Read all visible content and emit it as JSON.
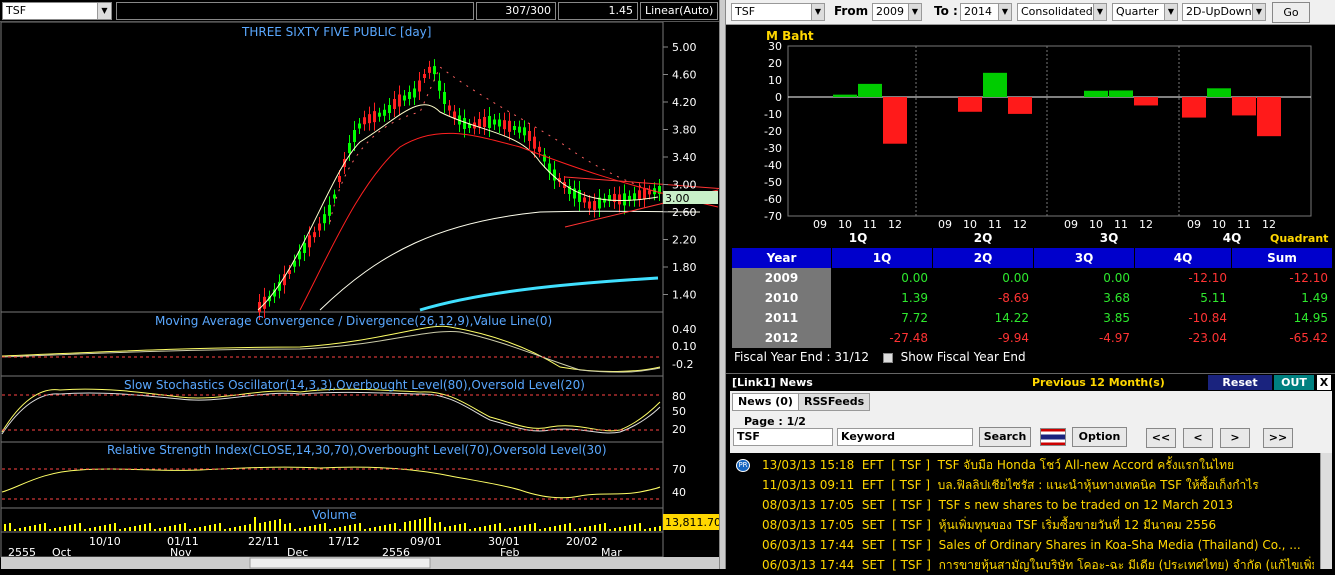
{
  "left": {
    "symbol": "TSF",
    "bars_info": "307/300",
    "zoom": "1.45",
    "scale": "Linear(Auto)",
    "chart_title": "THREE SIXTY FIVE PUBLIC [day]",
    "price_ticks": [
      "5.00",
      "4.60",
      "4.20",
      "3.80",
      "3.40",
      "3.00",
      "2.60",
      "2.20",
      "1.80",
      "1.40"
    ],
    "last_price": "3.00",
    "macd_title": "Moving Average Convergence / Divergence(26,12,9),Value Line(0)",
    "macd_ticks": [
      "0.40",
      "0.10",
      "-0.2"
    ],
    "stoch_title": "Slow Stochastics Oscillator(14,3,3),Overbought Level(80),Oversold Level(20)",
    "stoch_ticks": [
      "80",
      "50",
      "20"
    ],
    "rsi_title": "Relative Strength Index(CLOSE,14,30,70),Overbought Level(70),Oversold Level(30)",
    "rsi_ticks": [
      "70",
      "40"
    ],
    "volume_title": "Volume",
    "volume_value": "13,811.70",
    "date_top": [
      "10/10",
      "01/11",
      "22/11",
      "17/12",
      "09/01",
      "30/01",
      "20/02"
    ],
    "date_bottom": [
      "2555",
      "Oct",
      "Nov",
      "Dec",
      "2556",
      "Feb",
      "Mar"
    ]
  },
  "right": {
    "symbol": "TSF",
    "from_label": "From :",
    "from_year": "2009",
    "to_label": "To :",
    "to_year": "2014",
    "statement": "Consolidated",
    "period": "Quarter",
    "chart_mode": "2D-UpDown",
    "go_label": "Go",
    "unit": "M Baht",
    "quadrant_label": "Quadrant",
    "fiscal_text": "Fiscal  Year  End  :  31/12",
    "show_fiscal_label": "Show Fiscal Year End"
  },
  "chart_data": {
    "type": "bar",
    "ylabel": "M Baht",
    "ylim": [
      -70,
      30
    ],
    "yticks": [
      30,
      20,
      10,
      0,
      -10,
      -20,
      -30,
      -40,
      -50,
      -60,
      -70
    ],
    "groups": [
      "1Q",
      "2Q",
      "3Q",
      "4Q"
    ],
    "x_labels": [
      "09",
      "10",
      "11",
      "12"
    ],
    "series": [
      {
        "values": [
          0.0,
          1.39,
          7.72,
          -27.48
        ]
      },
      {
        "values": [
          0.0,
          -8.69,
          14.22,
          -9.94
        ]
      },
      {
        "values": [
          0.0,
          3.68,
          3.85,
          -4.97
        ]
      },
      {
        "values": [
          -12.1,
          5.11,
          -10.84,
          -23.04
        ]
      }
    ]
  },
  "table": {
    "headers": [
      "Year",
      "1Q",
      "2Q",
      "3Q",
      "4Q",
      "Sum"
    ],
    "rows": [
      {
        "year": "2009",
        "vals": [
          "0.00",
          "0.00",
          "0.00",
          "-12.10",
          "-12.10"
        ]
      },
      {
        "year": "2010",
        "vals": [
          "1.39",
          "-8.69",
          "3.68",
          "5.11",
          "1.49"
        ]
      },
      {
        "year": "2011",
        "vals": [
          "7.72",
          "14.22",
          "3.85",
          "-10.84",
          "14.95"
        ]
      },
      {
        "year": "2012",
        "vals": [
          "-27.48",
          "-9.94",
          "-4.97",
          "-23.04",
          "-65.42"
        ]
      }
    ]
  },
  "news": {
    "panel_title": "[Link1] News",
    "period": "Previous 12 Month(s)",
    "reset": "Reset",
    "out": "OUT",
    "close": "X",
    "tab_news": "News (0)",
    "tab_rss": "RSSFeeds",
    "page": "Page : 1/2",
    "symbol": "TSF",
    "keyword": "Keyword",
    "search": "Search",
    "option": "Option",
    "first": "<<",
    "prev": "<",
    "next": ">",
    "last": ">>",
    "items": [
      {
        "dt": "13/03/13 15:18",
        "src": "EFT",
        "sym": "[ TSF ]",
        "title": "TSF จับมือ Honda โชว์ All-new Accord ครั้งแรกในไทย"
      },
      {
        "dt": "11/03/13 09:11",
        "src": "EFT",
        "sym": "[ TSF ]",
        "title": "บล.ฟิลลิปเชียไซรัส : แนะนำหุ้นทางเทคนิค TSF ให้ซื้อเก็งกำไร"
      },
      {
        "dt": "08/03/13 17:05",
        "src": "SET",
        "sym": "[ TSF ]",
        "title": "TSF s new shares to be traded on 12 March 2013"
      },
      {
        "dt": "08/03/13 17:05",
        "src": "SET",
        "sym": "[ TSF ]",
        "title": "หุ้นเพิ่มทุนของ TSF เริ่มซื้อขายวันที่ 12 มีนาคม 2556"
      },
      {
        "dt": "06/03/13 17:44",
        "src": "SET",
        "sym": "[ TSF ]",
        "title": "Sales of Ordinary Shares in Koa-Sha Media (Thailand) Co., ..."
      },
      {
        "dt": "06/03/13 17:44",
        "src": "SET",
        "sym": "[ TSF ]",
        "title": "การขายหุ้นสามัญในบริษัท โคอะ-ฉะ มีเดีย (ประเทศไทย) จำกัด (แก้ไขเพิ่มเติม)"
      }
    ]
  }
}
